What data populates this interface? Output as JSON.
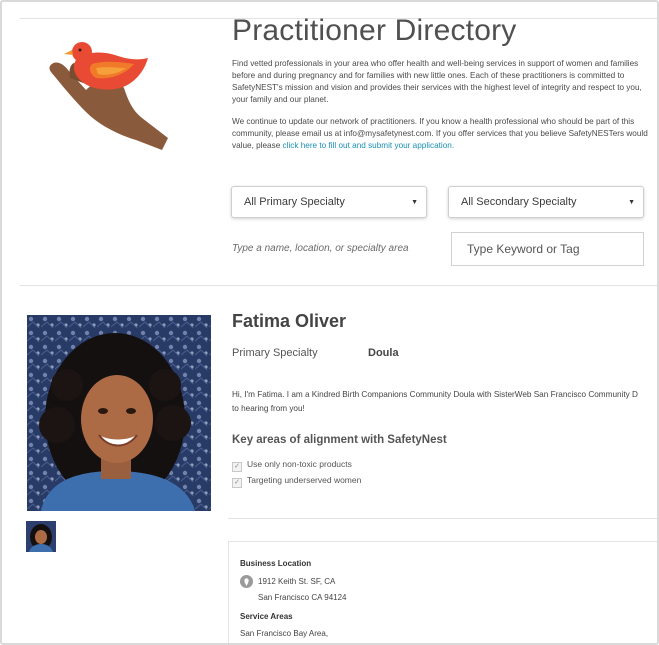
{
  "directory": {
    "title": "Practitioner Directory",
    "intro_1": "Find vetted professionals in your area who offer health and well-being services in support of women and families before and during pregnancy and for families with new little ones. Each of these practitioners is committed to SafetyNEST's mission and vision and provides their services with the highest level of integrity and respect to you, your family and our planet.",
    "intro_2_text": "We continue to update our network of practitioners. If you know a health professional who should be part of this community, please email us at info@mysafetynest.com. If you offer services that you believe SafetyNESTers would value, please ",
    "intro_2_link": "click here to fill out and submit your application."
  },
  "filters": {
    "primary_specialty": "All Primary Specialty",
    "secondary_specialty": "All Secondary Specialty",
    "search_hint": "Type a name, location, or specialty area",
    "keyword_placeholder": "Type Keyword or Tag"
  },
  "practitioner": {
    "name": "Fatima Oliver",
    "primary_specialty_label": "Primary Specialty",
    "primary_specialty_value": "Doula",
    "bio_line_1": "Hi, I'm Fatima. I am a Kindred Birth Companions Community Doula with SisterWeb San Francisco Community D",
    "bio_line_2": "to hearing from you!",
    "alignment_heading": "Key areas of alignment with SafetyNest",
    "alignment_items": [
      "Use only non-toxic products",
      "Targeting underserved women"
    ],
    "business_location_label": "Business Location",
    "address_line_1": "1912 Keith St. SF, CA",
    "address_line_2": "San Francisco CA 94124",
    "service_areas_label": "Service Areas",
    "service_areas_value": "San Francisco Bay Area,"
  },
  "colors": {
    "link": "#1b8fb6",
    "bird": "#e84a33",
    "hand": "#8a5a3c"
  },
  "icons": {
    "logo": "hand-holding-bird-logo",
    "caret": "caret-down-icon",
    "pin": "map-pin-icon",
    "check": "checkbox-icon"
  }
}
